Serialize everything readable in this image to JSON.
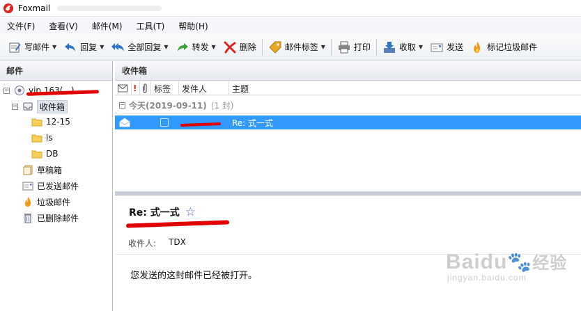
{
  "window": {
    "title": "Foxmail"
  },
  "menu": [
    "文件(F)",
    "查看(V)",
    "邮件(M)",
    "工具(T)",
    "帮助(H)"
  ],
  "toolbar": {
    "compose": "写邮件",
    "reply": "回复",
    "reply_all": "全部回复",
    "forward": "转发",
    "delete": "删除",
    "tags": "邮件标签",
    "print": "打印",
    "receive": "收取",
    "send": "发送",
    "spam": "标记垃圾邮件"
  },
  "left_pane": {
    "header": "邮件",
    "account": "vip.163(...)",
    "inbox": "收件箱",
    "folders": [
      "12-15",
      "ls",
      "DB"
    ],
    "drafts": "草稿箱",
    "sent": "已发送邮件",
    "junk": "垃圾邮件",
    "deleted": "已删除邮件"
  },
  "list": {
    "header": "收件箱",
    "columns": {
      "tag": "标签",
      "sender": "发件人",
      "subject": "主题"
    },
    "group": {
      "date": "今天(2019-09-11)",
      "count": "(1 封)"
    },
    "rows": [
      {
        "sender": "...",
        "subject": "Re: 式一式"
      }
    ]
  },
  "preview": {
    "subject": "Re: 式一式",
    "recipient_label": "收件人:",
    "recipient": "TDX",
    "body": "您发送的这封邮件已经被打开。"
  },
  "watermark": {
    "brand": "Baidu",
    "suffix": "经验",
    "url": "jingyan.baidu.com"
  },
  "colors": {
    "selection": "#3399ff",
    "redaction": "#e00000"
  }
}
